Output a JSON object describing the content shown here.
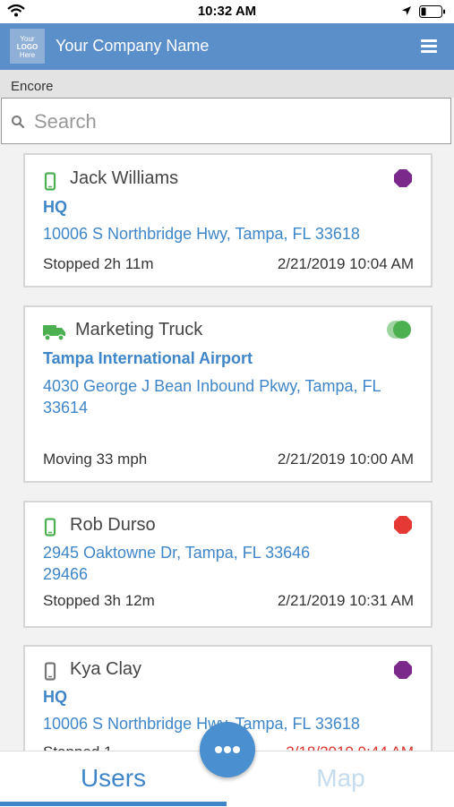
{
  "status_bar": {
    "time": "10:32 AM"
  },
  "header": {
    "logo_lines": [
      "Your",
      "LOGO",
      "Here"
    ],
    "company_name": "Your Company Name"
  },
  "sub_header": {
    "title": "Encore"
  },
  "search": {
    "placeholder": "Search",
    "value": ""
  },
  "cards": [
    {
      "name": "Jack Williams",
      "device_icon": "phone-icon",
      "device_color": "#4caf50",
      "place": "HQ",
      "address": "10006 S Northbridge Hwy, Tampa, FL 33618",
      "status": "Stopped 2h 11m",
      "time": "2/21/2019 10:04 AM",
      "status_icon": "octagon-stop-icon",
      "status_color": "#7b2a8c"
    },
    {
      "name": "Marketing Truck",
      "device_icon": "truck-icon",
      "device_color": "#4caf50",
      "place": "Tampa International Airport",
      "address": "4030 George J Bean Inbound Pkwy, Tampa, FL 33614",
      "status": "Moving 33 mph",
      "time": "2/21/2019 10:00 AM",
      "status_icon": "moving-circle-icon",
      "status_color": "#4caf50"
    },
    {
      "name": "Rob Durso",
      "device_icon": "phone-icon",
      "device_color": "#4caf50",
      "place": "",
      "address": "2945 Oaktowne Dr, Tampa, FL 33646 29466",
      "status": "Stopped 3h 12m",
      "time": "2/21/2019 10:31 AM",
      "status_icon": "octagon-stop-icon",
      "status_color": "#e53935"
    },
    {
      "name": "Kya Clay",
      "device_icon": "phone-icon",
      "device_color": "#777777",
      "place": "HQ",
      "address": "10006 S Northbridge Hwy, Tampa, FL 33618",
      "status": "Stopped 1",
      "time": "2/18/2019 9:44 AM",
      "status_icon": "octagon-stop-icon",
      "status_color": "#7b2a8c"
    }
  ],
  "tabs": [
    {
      "label": "Users",
      "active": true
    },
    {
      "label": "Map",
      "active": false
    }
  ],
  "colors": {
    "header": "#5b8fc9",
    "accent": "#3f86c8"
  }
}
